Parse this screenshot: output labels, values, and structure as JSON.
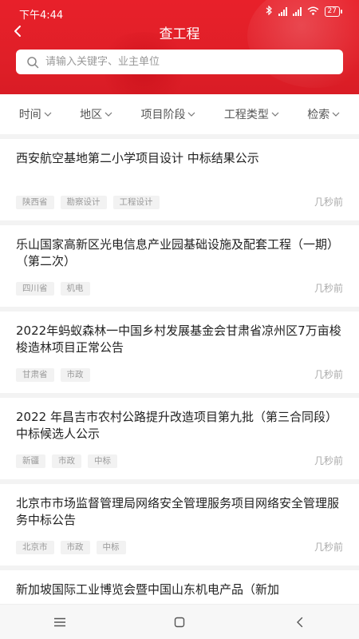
{
  "status_bar": {
    "time": "下午4:44",
    "icons": [
      "bluetooth-icon",
      "signal-icon",
      "hd-signal-icon",
      "wifi-icon",
      "battery-icon"
    ],
    "battery": "27"
  },
  "header": {
    "title": "查工程",
    "back_icon": "chevron-left-icon",
    "accent_color": "#e01f28"
  },
  "search": {
    "placeholder": "请输入关键字、业主单位",
    "value": ""
  },
  "filters": [
    {
      "label": "时间"
    },
    {
      "label": "地区"
    },
    {
      "label": "项目阶段"
    },
    {
      "label": "工程类型"
    },
    {
      "label": "检索"
    }
  ],
  "items": [
    {
      "title": "西安航空基地第二小学项目设计 中标结果公示",
      "tags": [
        "陕西省",
        "勘察设计",
        "工程设计"
      ],
      "time": "几秒前"
    },
    {
      "title": "乐山国家高新区光电信息产业园基础设施及配套工程（一期）（第二次）",
      "tags": [
        "四川省",
        "机电"
      ],
      "time": "几秒前"
    },
    {
      "title": "2022年蚂蚁森林一中国乡村发展基金会甘肃省凉州区7万亩梭梭造林项目正常公告",
      "tags": [
        "甘肃省",
        "市政"
      ],
      "time": "几秒前"
    },
    {
      "title": "2022 年昌吉市农村公路提升改造项目第九批（第三合同段）中标候选人公示",
      "tags": [
        "新疆",
        "市政",
        "中标"
      ],
      "time": "几秒前"
    },
    {
      "title": "北京市市场监督管理局网络安全管理服务项目网络安全管理服务中标公告",
      "tags": [
        "北京市",
        "市政",
        "中标"
      ],
      "time": "几秒前"
    },
    {
      "title": "新加坡国际工业博览会暨中国山东机电产品（新加",
      "tags": [],
      "time": ""
    }
  ],
  "nav": [
    "menu-icon",
    "home-icon",
    "back-icon"
  ]
}
